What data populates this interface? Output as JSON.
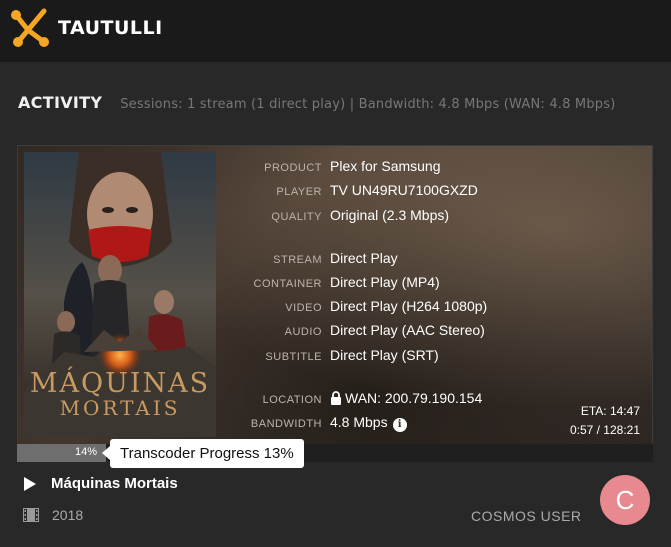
{
  "brand": {
    "name": "TAUTULLI",
    "accent_color": "#e5397c",
    "logo_color": "#f5a623"
  },
  "activity": {
    "title": "ACTIVITY",
    "stats": "Sessions: 1 stream (1 direct play) | Bandwidth: 4.8 Mbps (WAN: 4.8 Mbps)"
  },
  "poster": {
    "title_line1": "MÁQUINAS",
    "title_line2": "MORTAIS"
  },
  "details": [
    {
      "label": "PRODUCT",
      "value": "Plex for Samsung"
    },
    {
      "label": "PLAYER",
      "value": "TV UN49RU7100GXZD"
    },
    {
      "label": "QUALITY",
      "value": "Original (2.3 Mbps)"
    },
    {
      "label": "STREAM",
      "value": "Direct Play"
    },
    {
      "label": "CONTAINER",
      "value": "Direct Play (MP4)"
    },
    {
      "label": "VIDEO",
      "value": "Direct Play (H264 1080p)"
    },
    {
      "label": "AUDIO",
      "value": "Direct Play (AAC Stereo)"
    },
    {
      "label": "SUBTITLE",
      "value": "Direct Play (SRT)"
    },
    {
      "label": "LOCATION",
      "value": "WAN: 200.79.190.154",
      "icon": "lock-icon"
    },
    {
      "label": "BANDWIDTH",
      "value": "4.8 Mbps",
      "icon": "info-icon"
    }
  ],
  "eta": {
    "label": "ETA: 14:47",
    "time": "0:57 / 128:21"
  },
  "progress": {
    "percent_label": "14%",
    "fraction": 0.14,
    "tooltip": "Transcoder Progress 13%"
  },
  "footer": {
    "play_icon": "play-icon",
    "title": "Máquinas Mortais",
    "film_icon": "film-icon",
    "year": "2018"
  },
  "user": {
    "name": "COSMOS USER",
    "avatar_letter": "C",
    "avatar_color": "#e8898f"
  }
}
